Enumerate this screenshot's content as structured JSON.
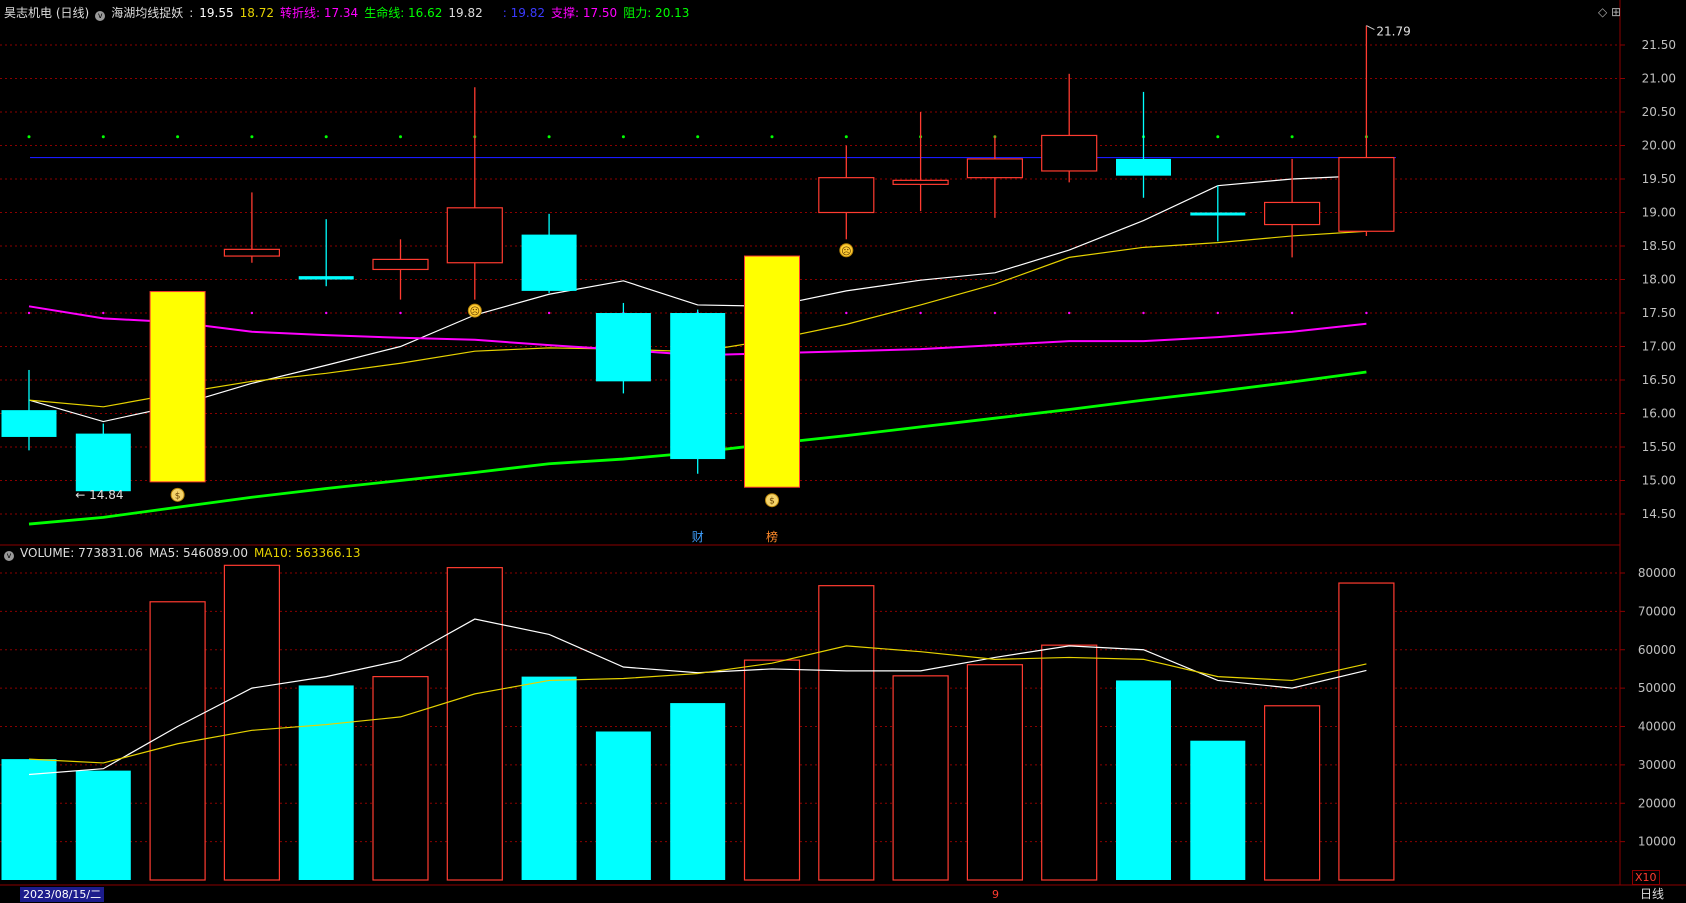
{
  "colors": {
    "up": "#ff3b30",
    "down": "#00ffff",
    "limit_up": "#ffff00",
    "ma5": "#ffffff",
    "ma10": "#e6d200",
    "turn": "#ff00ff",
    "life": "#00ff00",
    "resist": "#1a1aff",
    "grid": "#8b0000",
    "axis_text": "#c0c0c0"
  },
  "header": {
    "stock": "昊志机电 (日线)",
    "indicator": "海湖均线捉妖",
    "v1": "19.55",
    "v2": "18.72",
    "turn_label": "转折线: 17.34",
    "life_label": "生命线: 16.62",
    "v3": "19.82",
    "v4": ": 19.82",
    "support_label": "支撑: 17.50",
    "resist_label": "阻力: 20.13",
    "top_right_icons": "◇ ⊞"
  },
  "volume_header": {
    "volume": "VOLUME: 773831.06",
    "ma5": "MA5: 546089.00",
    "ma10": "MA10: 563366.13"
  },
  "footer": {
    "date": "2023/08/15/二",
    "mark": "9",
    "unit": "X10",
    "period": "日线"
  },
  "annotations": {
    "high_label": "21.79",
    "low_label": "14.84",
    "event_marks": [
      "财",
      "榜"
    ],
    "money_icon": "$",
    "face_icon": "☹"
  },
  "chart_data": [
    {
      "type": "candlestick",
      "ylim": [
        14.2,
        21.8
      ],
      "yticks": [
        14.5,
        15.0,
        15.5,
        16.0,
        16.5,
        17.0,
        17.5,
        18.0,
        18.5,
        19.0,
        19.5,
        20.0,
        20.5,
        21.0,
        21.5
      ],
      "candles": [
        {
          "o": 16.05,
          "c": 15.65,
          "h": 16.65,
          "l": 15.45,
          "kind": "down"
        },
        {
          "o": 15.7,
          "c": 14.84,
          "h": 15.85,
          "l": 14.84,
          "kind": "down"
        },
        {
          "o": 14.98,
          "c": 17.82,
          "h": 17.82,
          "l": 14.98,
          "kind": "limit"
        },
        {
          "o": 18.35,
          "c": 18.45,
          "h": 19.3,
          "l": 18.25,
          "kind": "up"
        },
        {
          "o": 18.05,
          "c": 18.0,
          "h": 18.9,
          "l": 17.9,
          "kind": "down"
        },
        {
          "o": 18.15,
          "c": 18.3,
          "h": 18.6,
          "l": 17.7,
          "kind": "up"
        },
        {
          "o": 18.25,
          "c": 19.07,
          "h": 20.87,
          "l": 17.7,
          "kind": "up"
        },
        {
          "o": 18.67,
          "c": 17.83,
          "h": 18.98,
          "l": 17.8,
          "kind": "down"
        },
        {
          "o": 17.5,
          "c": 16.48,
          "h": 17.65,
          "l": 16.3,
          "kind": "down"
        },
        {
          "o": 17.5,
          "c": 15.32,
          "h": 17.55,
          "l": 15.1,
          "kind": "down"
        },
        {
          "o": 14.9,
          "c": 18.35,
          "h": 18.35,
          "l": 14.9,
          "kind": "limit"
        },
        {
          "o": 19.0,
          "c": 19.52,
          "h": 20.0,
          "l": 18.6,
          "kind": "up"
        },
        {
          "o": 19.42,
          "c": 19.48,
          "h": 20.5,
          "l": 19.02,
          "kind": "up"
        },
        {
          "o": 19.52,
          "c": 19.8,
          "h": 20.15,
          "l": 18.92,
          "kind": "up"
        },
        {
          "o": 19.62,
          "c": 20.15,
          "h": 21.07,
          "l": 19.45,
          "kind": "up"
        },
        {
          "o": 19.8,
          "c": 19.55,
          "h": 20.8,
          "l": 19.22,
          "kind": "down"
        },
        {
          "o": 19.0,
          "c": 18.97,
          "h": 19.4,
          "l": 18.57,
          "kind": "down"
        },
        {
          "o": 18.82,
          "c": 19.15,
          "h": 19.8,
          "l": 18.33,
          "kind": "up"
        },
        {
          "o": 18.72,
          "c": 19.82,
          "h": 21.79,
          "l": 18.65,
          "kind": "up"
        }
      ],
      "series": [
        {
          "name": "MA5",
          "values": [
            16.2,
            15.88,
            16.12,
            16.45,
            16.72,
            17.0,
            17.47,
            17.78,
            17.98,
            17.62,
            17.6,
            17.83,
            17.99,
            18.1,
            18.44,
            18.88,
            19.4,
            19.5,
            19.55
          ]
        },
        {
          "name": "MA10",
          "values": [
            16.2,
            16.1,
            16.3,
            16.48,
            16.6,
            16.75,
            16.93,
            16.98,
            16.96,
            16.92,
            17.1,
            17.33,
            17.62,
            17.93,
            18.33,
            18.48,
            18.55,
            18.65,
            18.72
          ]
        },
        {
          "name": "转折线",
          "values": [
            17.6,
            17.42,
            17.36,
            17.22,
            17.17,
            17.13,
            17.1,
            17.02,
            16.95,
            16.87,
            16.9,
            16.93,
            16.96,
            17.02,
            17.08,
            17.08,
            17.14,
            17.22,
            17.34
          ]
        },
        {
          "name": "生命线",
          "values": [
            14.35,
            14.45,
            14.6,
            14.75,
            14.88,
            15.0,
            15.12,
            15.25,
            15.32,
            15.42,
            15.55,
            15.67,
            15.8,
            15.93,
            16.06,
            16.2,
            16.33,
            16.47,
            16.62
          ]
        }
      ],
      "resist_line": 19.82,
      "support_dots": 17.5,
      "resist_dots": 20.13
    },
    {
      "type": "bar",
      "ylabel": "X10",
      "ylim": [
        0,
        85000
      ],
      "yticks": [
        10000,
        20000,
        30000,
        40000,
        50000,
        60000,
        70000,
        80000
      ],
      "values": [
        31500,
        28500,
        72500,
        82000,
        50700,
        53000,
        81400,
        53000,
        38700,
        46100,
        57300,
        76700,
        53200,
        56100,
        61200,
        52000,
        36300,
        45400,
        77383
      ],
      "series": [
        {
          "name": "MA5",
          "values": [
            27500,
            29000,
            40000,
            50000,
            53000,
            57200,
            68000,
            64000,
            55500,
            54000,
            55000,
            54500,
            54500,
            58000,
            61000,
            60000,
            52000,
            50000,
            54600
          ]
        },
        {
          "name": "MA10",
          "values": [
            31500,
            30500,
            35500,
            39000,
            40500,
            42500,
            48500,
            52000,
            52500,
            53800,
            56500,
            61000,
            59500,
            57500,
            58000,
            57500,
            53000,
            52000,
            56300
          ]
        }
      ]
    }
  ]
}
